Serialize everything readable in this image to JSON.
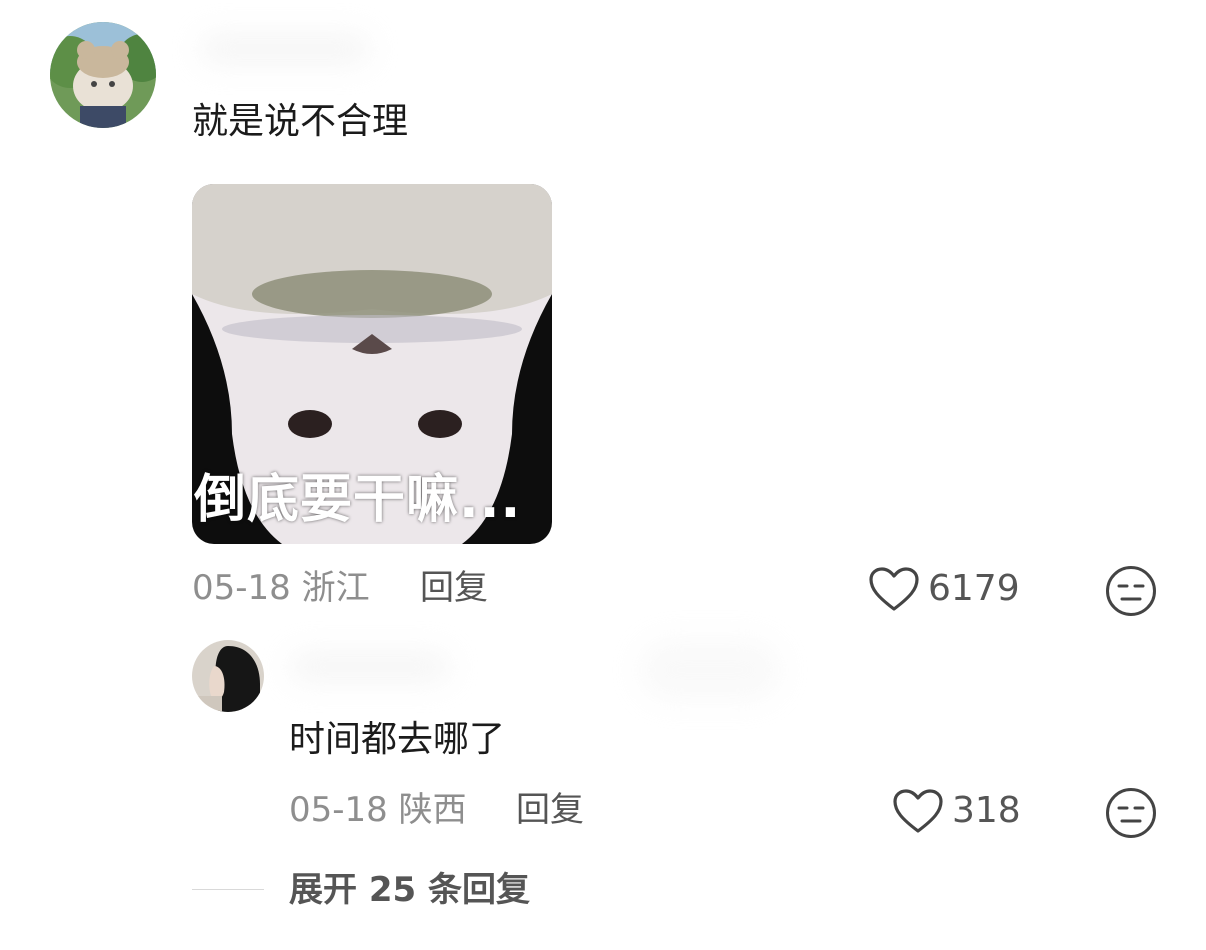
{
  "comment": {
    "text": "就是说不合理",
    "sticker_caption": "倒底要干嘛...",
    "date": "05-18",
    "location": "浙江",
    "reply_label": "回复",
    "likes": "6179",
    "icons": {
      "like": "heart-outline-icon",
      "dislike": "meh-face-icon"
    }
  },
  "reply": {
    "text": "时间都去哪了",
    "date": "05-18",
    "location": "陕西",
    "reply_label": "回复",
    "likes": "318"
  },
  "expand": {
    "label": "展开 25 条回复"
  }
}
